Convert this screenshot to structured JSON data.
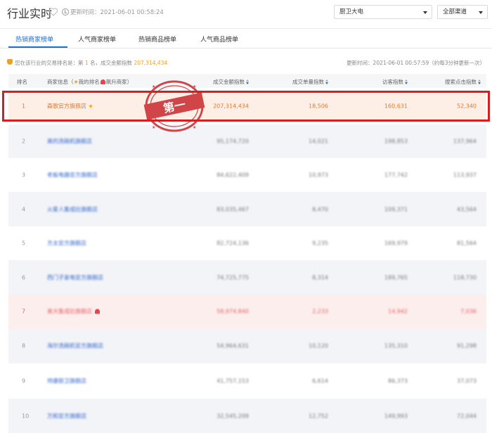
{
  "header": {
    "title": "行业实时",
    "update_time": "更新时间：2021-06-01 00:58:24",
    "category_select": "厨卫大电",
    "channel_select": "全部渠道"
  },
  "tabs": [
    "热销商家榜单",
    "人气商家榜单",
    "热销商品榜单",
    "人气商品榜单"
  ],
  "info": {
    "prefix": "您在该行业的交易排名是：第",
    "rank": "1",
    "middle": "名，成交金额指数",
    "amount": "207,314,434",
    "right": "更新时间：2021-06-01 00:57:59（约每3分钟更新一次）"
  },
  "table": {
    "headers": {
      "rank": "排名",
      "shop_prefix": "商家信息（",
      "my_rank": "我的排名",
      "rising": "飙升商家）",
      "gmv": "成交金额指数",
      "orders": "成交单量指数",
      "visitors": "访客指数",
      "search": "搜索点击指数"
    },
    "rows": [
      {
        "rank": "1",
        "shop": "森歌官方旗舰店",
        "gmv": "207,314,434",
        "orders": "18,506",
        "visitors": "160,631",
        "search": "52,340"
      },
      {
        "rank": "2",
        "shop": "美的洗碗机旗舰店",
        "gmv": "95,174,720",
        "orders": "14,021",
        "visitors": "198,853",
        "search": "137,964"
      },
      {
        "rank": "3",
        "shop": "老板电器官方旗舰店",
        "gmv": "84,622,409",
        "orders": "10,973",
        "visitors": "177,742",
        "search": "113,937"
      },
      {
        "rank": "4",
        "shop": "火星人集成灶旗舰店",
        "gmv": "83,035,467",
        "orders": "8,470",
        "visitors": "109,371",
        "search": "43,564"
      },
      {
        "rank": "5",
        "shop": "方太官方旗舰店",
        "gmv": "82,724,136",
        "orders": "9,235",
        "visitors": "169,979",
        "search": "81,564"
      },
      {
        "rank": "6",
        "shop": "西门子家电官方旗舰店",
        "gmv": "74,725,775",
        "orders": "8,314",
        "visitors": "189,765",
        "search": "118,730"
      },
      {
        "rank": "7",
        "shop": "美大集成灶旗舰店",
        "gmv": "58,974,840",
        "orders": "2,233",
        "visitors": "14,942",
        "search": "7,036"
      },
      {
        "rank": "8",
        "shop": "海尔洗碗机官方旗舰店",
        "gmv": "54,964,631",
        "orders": "10,120",
        "visitors": "135,310",
        "search": "91,298"
      },
      {
        "rank": "9",
        "shop": "帅康厨卫旗舰店",
        "gmv": "41,757,153",
        "orders": "6,614",
        "visitors": "86,373",
        "search": "37,073"
      },
      {
        "rank": "10",
        "shop": "万和官方旗舰店",
        "gmv": "32,545,209",
        "orders": "12,752",
        "visitors": "149,993",
        "search": "72,044"
      }
    ]
  },
  "stamp": {
    "text": "第一"
  },
  "colors": {
    "accent": "#1a6fd6",
    "highlight": "#e07a2b",
    "box": "#d31f1f"
  }
}
